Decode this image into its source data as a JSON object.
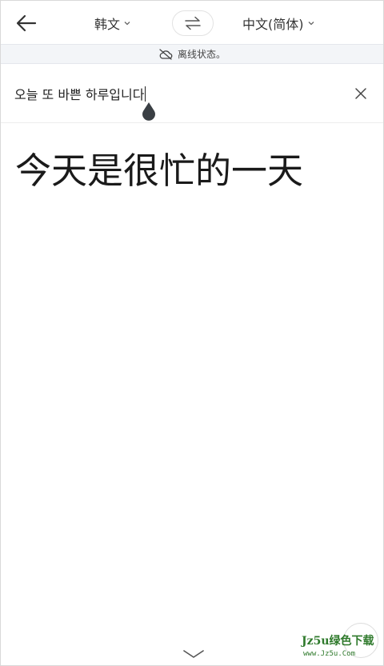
{
  "header": {
    "source_language": "韩文",
    "target_language": "中文(简体)"
  },
  "offline_banner": {
    "text": "离线状态。"
  },
  "source": {
    "text": "오늘 또 바쁜 하루입니다"
  },
  "result": {
    "text": "今天是很忙的一天"
  },
  "watermark": {
    "text": "Jz5u绿色下载",
    "sub": "www.Jz5u.Com"
  },
  "icons": {
    "back": "arrow-left-icon",
    "swap": "swap-arrows-icon",
    "offline": "cloud-off-icon",
    "clear": "close-icon",
    "collapse": "chevron-down-icon"
  },
  "colors": {
    "banner_bg": "#f3f5f8",
    "caret_handle": "#3a3f44",
    "watermark": "#2f7a2c"
  }
}
